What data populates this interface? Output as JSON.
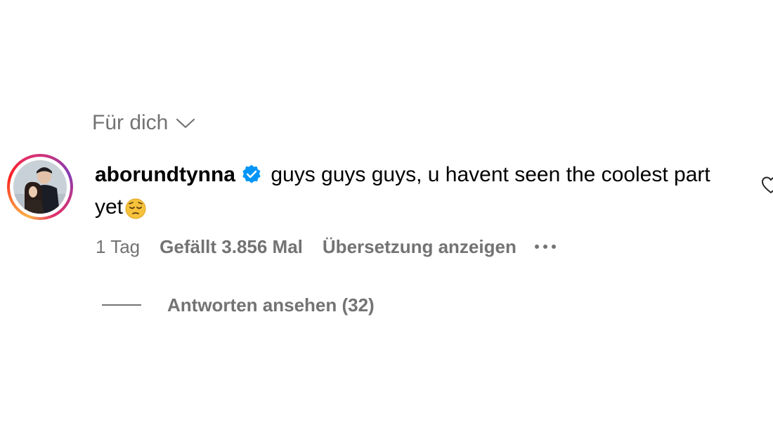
{
  "filter": {
    "label": "Für dich",
    "icon": "chevron-down-icon"
  },
  "comment": {
    "username": "aborundtynna",
    "verified": true,
    "text": "guys guys guys, u havent seen the coolest part yet",
    "emoji": "😔",
    "time": "1 Tag",
    "likes": "Gefällt 3.856 Mal",
    "translate": "Übersetzung anzeigen",
    "replies": "Antworten ansehen (32)"
  },
  "colors": {
    "muted_text": "#737373",
    "verified_blue": "#0095f6"
  }
}
